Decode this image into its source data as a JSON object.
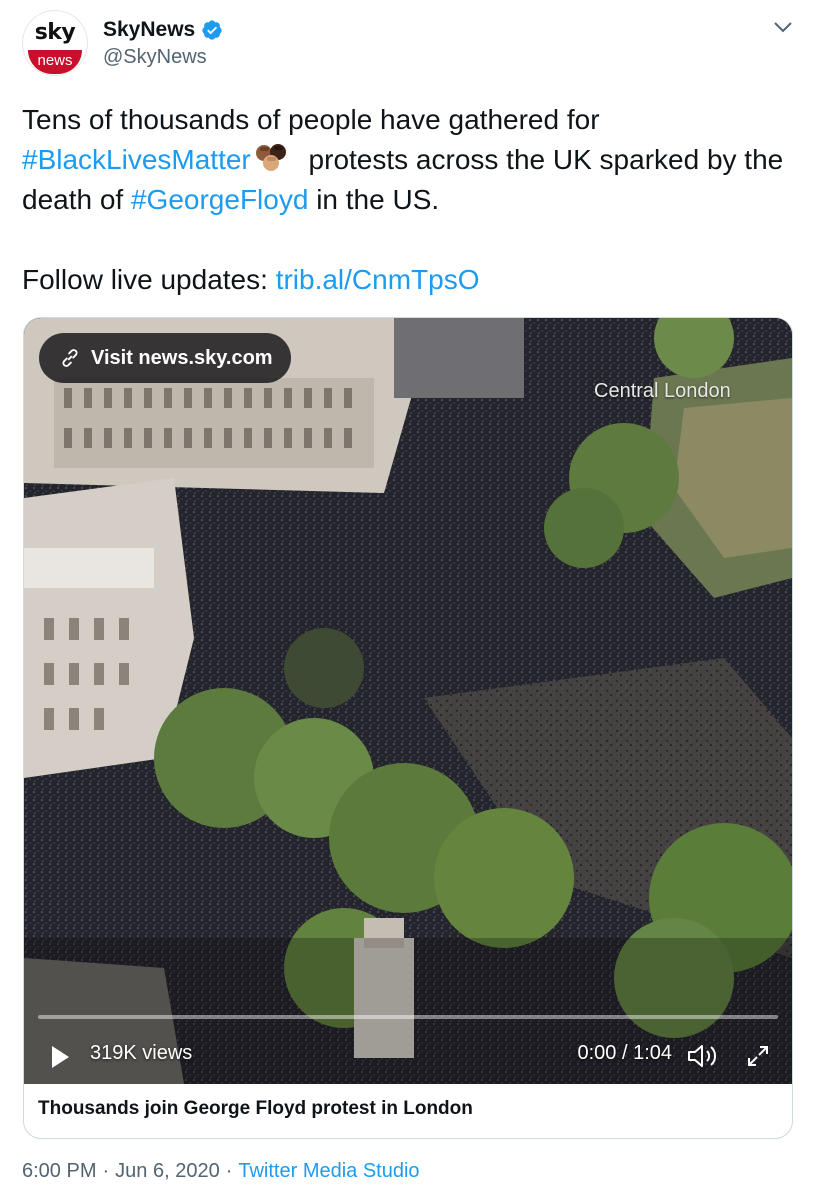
{
  "header": {
    "avatar_top": "sky",
    "avatar_bottom": "news",
    "name": "SkyNews",
    "handle": "@SkyNews"
  },
  "tweet": {
    "t1": "Tens of thousands of people have gathered for",
    "hashtag1": "#BlackLivesMatter",
    "t2": " protests across the UK sparked by the death of ",
    "hashtag2": "#GeorgeFloyd",
    "t3": " in the US.",
    "follow_label": "Follow live updates: ",
    "follow_link": "trib.al/CnmTpsO"
  },
  "media": {
    "visit_label": "Visit news.sky.com",
    "overlay_caption": "Central London",
    "views": "319K views",
    "time": "0:00 / 1:04",
    "progress": 0,
    "card_title": "Thousands join George Floyd protest in London"
  },
  "footer": {
    "time": "6:00 PM",
    "date": "Jun 6, 2020",
    "source": "Twitter Media Studio"
  },
  "colors": {
    "link": "#1d9bf0",
    "verified": "#1d9bf0",
    "sky_red": "#c8102e"
  },
  "icons": [
    "verified-badge-icon",
    "chevron-down-icon",
    "raised-fist-emoji",
    "link-icon",
    "play-icon",
    "volume-icon",
    "expand-icon"
  ]
}
